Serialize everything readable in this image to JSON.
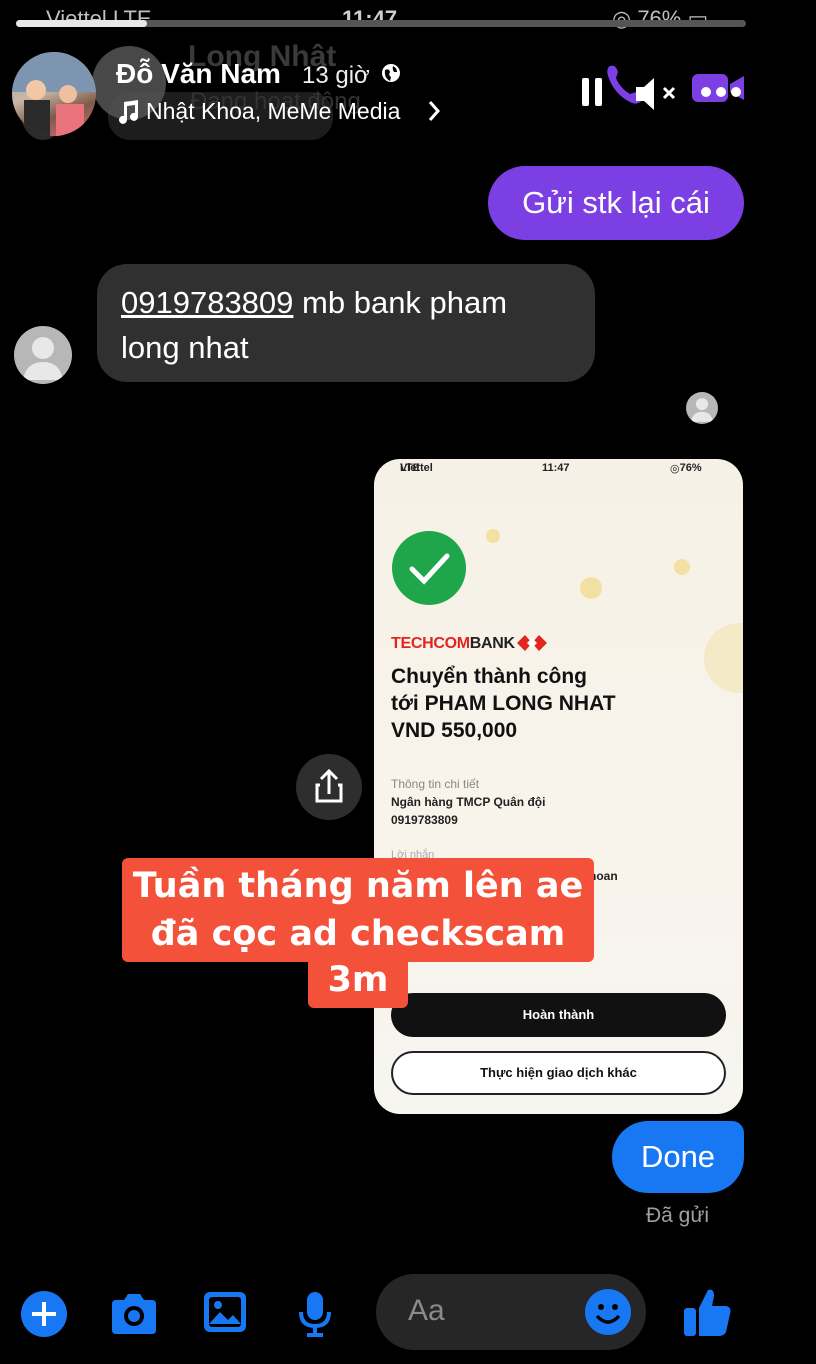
{
  "status_bar": {
    "carrier": "Viettel",
    "network": "LTE",
    "time": "11:47",
    "battery": "76%"
  },
  "story_progress": 0.18,
  "underlying_header": {
    "name": "Long Nhật",
    "status": "Đang hoạt động"
  },
  "header": {
    "name": "Đỗ Văn Nam",
    "time_ago": "13 giờ",
    "music": "Nhật Khoa, MeMe Media"
  },
  "messages": {
    "outgoing_1": "Gửi stk lại cái",
    "incoming_phone": "0919783809",
    "incoming_rest": " mb bank pham long nhat",
    "done": "Done",
    "sent_status": "Đã gửi"
  },
  "screenshot": {
    "carrier": "Viettel",
    "network": "LTE",
    "time": "11:47",
    "battery": "76%",
    "bank_red": "TECHCOM",
    "bank_dark": "BANK",
    "title_line1": "Chuyển thành công",
    "title_line2": "tới PHAM LONG NHAT",
    "title_line3": "VND 550,000",
    "detail_heading": "Thông tin chi tiết",
    "bank_name": "Ngân hàng TMCP Quân đội",
    "account": "0919783809",
    "message_label": "Lời nhắn",
    "message_fragment": "hoan",
    "button_primary": "Hoàn thành",
    "button_secondary": "Thực hiện giao dịch khác"
  },
  "caption": {
    "line1": "Tuần tháng năm lên ae",
    "line2": "đã cọc ad checkscam",
    "line3": "3m"
  },
  "composer": {
    "placeholder": "Aa"
  },
  "colors": {
    "outgoing_bubble": "#7b3fe4",
    "done_bubble": "#1877f2",
    "caption_bg": "#f4513a",
    "accent_blue": "#1877f2"
  }
}
